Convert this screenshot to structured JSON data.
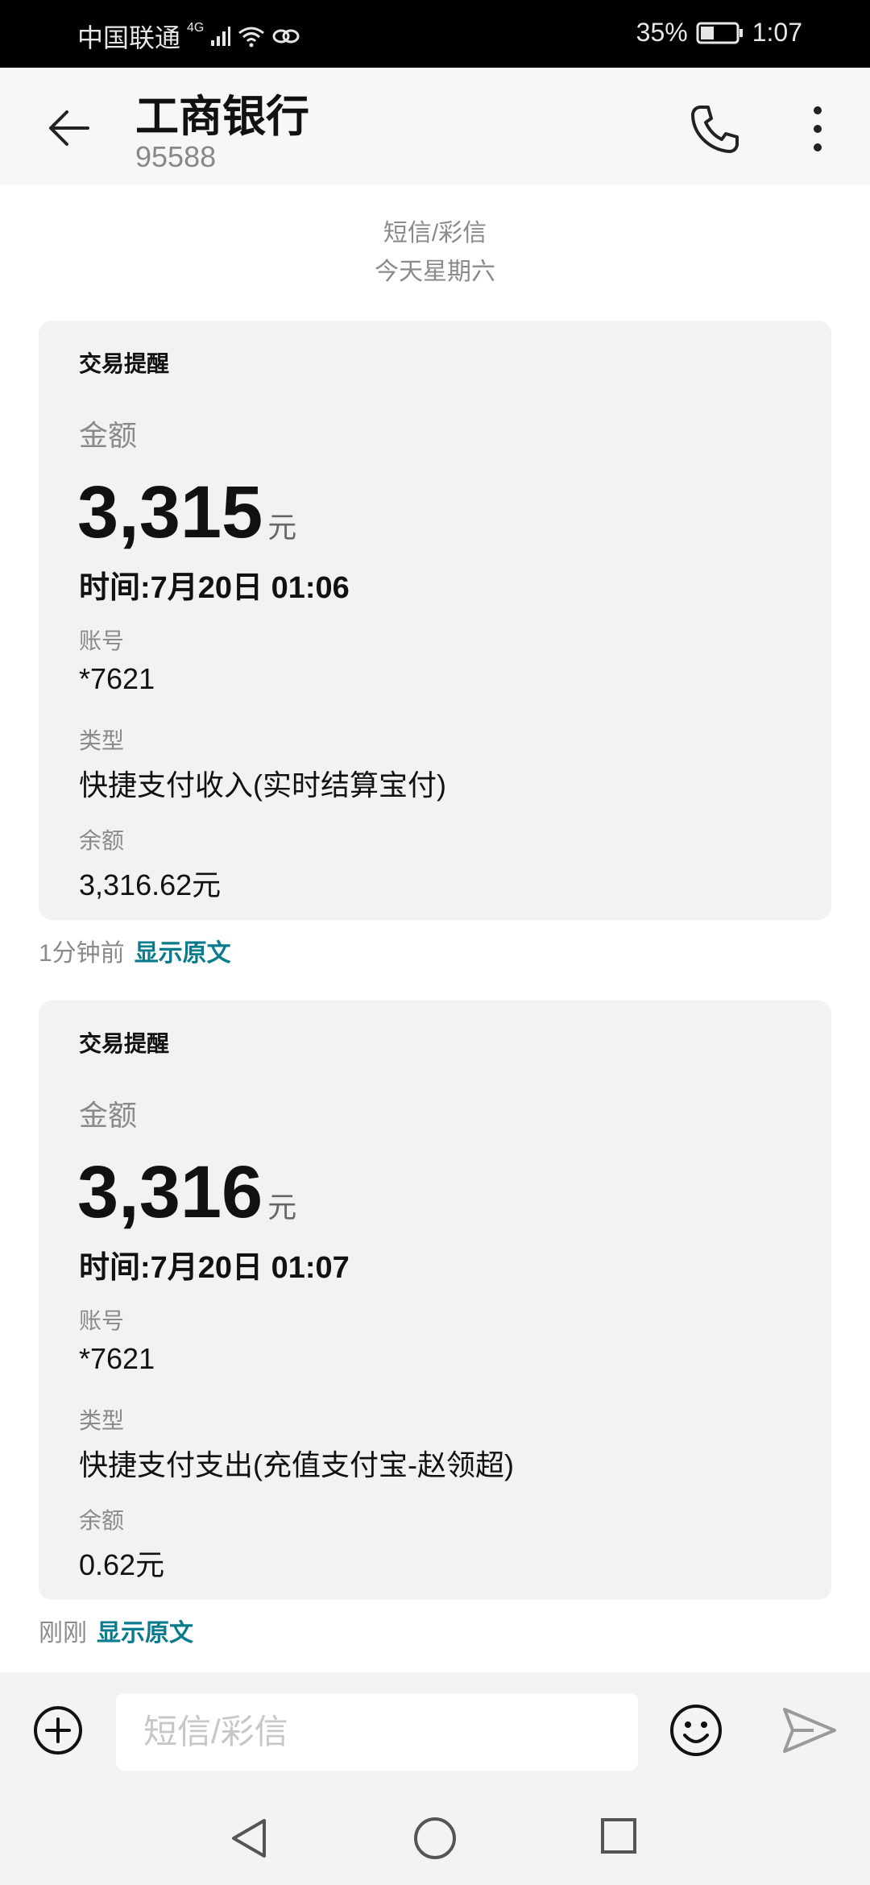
{
  "status_bar": {
    "carrier": "中国联通",
    "network": "4G",
    "battery": "35%",
    "time": "1:07"
  },
  "header": {
    "title": "工商银行",
    "number": "95588"
  },
  "thread_meta": {
    "type": "短信/彩信",
    "date": "今天星期六"
  },
  "messages": [
    {
      "card_title": "交易提醒",
      "amount_label": "金额",
      "amount": "3,315",
      "unit": "元",
      "time": "时间:7月20日 01:06",
      "account_label": "账号",
      "account": "*7621",
      "type_label": "类型",
      "type": "快捷支付收入(实时结算宝付)",
      "balance_label": "余额",
      "balance": "3,316.62元",
      "sent": "1分钟前",
      "show_original": "显示原文"
    },
    {
      "card_title": "交易提醒",
      "amount_label": "金额",
      "amount": "3,316",
      "unit": "元",
      "time": "时间:7月20日 01:07",
      "account_label": "账号",
      "account": "*7621",
      "type_label": "类型",
      "type": "快捷支付支出(充值支付宝-赵领超)",
      "balance_label": "余额",
      "balance": "0.62元",
      "sent": "刚刚",
      "show_original": "显示原文"
    }
  ],
  "composer": {
    "placeholder": "短信/彩信"
  },
  "icons": {
    "back": "arrow-left-icon",
    "call": "phone-icon",
    "more": "more-vertical-icon",
    "add": "plus-circle-icon",
    "emoji": "smile-icon",
    "send": "send-icon",
    "nav_back": "triangle-back-icon",
    "nav_home": "circle-home-icon",
    "nav_recents": "square-recents-icon"
  },
  "colors": {
    "link": "#0a7b8c",
    "card_bg": "#f2f2f2",
    "status_bg": "#000000"
  }
}
